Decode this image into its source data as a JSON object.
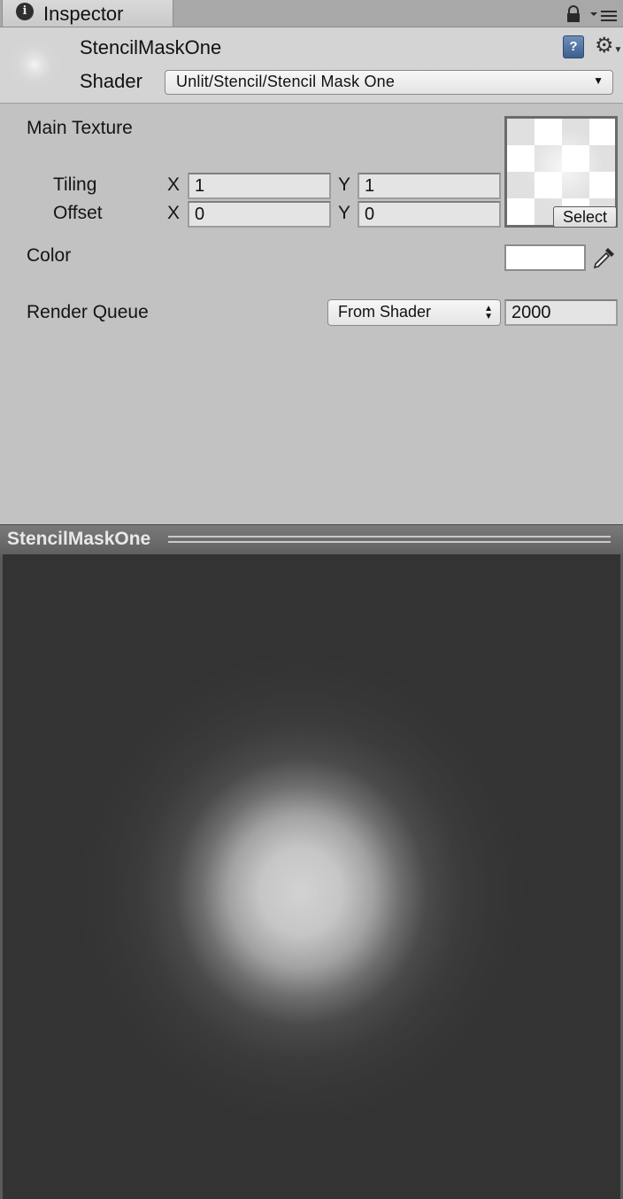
{
  "tab": {
    "title": "Inspector",
    "icon": "info-icon"
  },
  "header": {
    "material_name": "StencilMaskOne",
    "shader_label": "Shader",
    "shader_value": "Unlit/Stencil/Stencil Mask One"
  },
  "properties": {
    "main_texture": {
      "label": "Main Texture",
      "tiling_label": "Tiling",
      "offset_label": "Offset",
      "x_label": "X",
      "y_label": "Y",
      "tiling_x": "1",
      "tiling_y": "1",
      "offset_x": "0",
      "offset_y": "0",
      "select_label": "Select"
    },
    "color": {
      "label": "Color",
      "value": "#ffffff"
    },
    "render_queue": {
      "label": "Render Queue",
      "mode": "From Shader",
      "value": "2000"
    }
  },
  "preview": {
    "title": "StencilMaskOne"
  }
}
